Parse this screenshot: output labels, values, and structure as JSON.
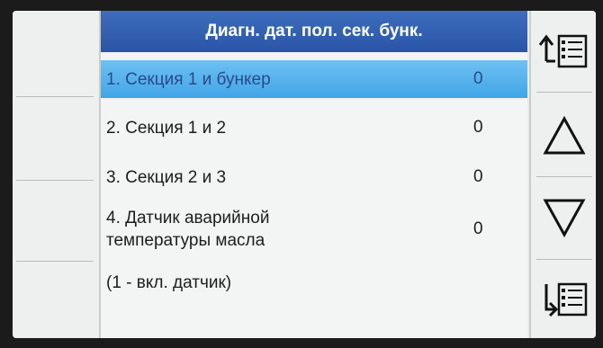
{
  "header": {
    "title": "Диагн. дат. пол. сек. бунк."
  },
  "rows": [
    {
      "label": "1. Секция 1 и бункер",
      "value": "0"
    },
    {
      "label": "2. Секция 1 и 2",
      "value": "0"
    },
    {
      "label": "3. Секция 2 и 3",
      "value": "0"
    },
    {
      "label_line1": "4. Датчик аварийной",
      "label_line2": "температуры масла",
      "value": "0"
    }
  ],
  "note": "(1 - вкл. датчик)",
  "right_buttons": [
    {
      "icon": "menu-up-icon"
    },
    {
      "icon": "triangle-up-icon"
    },
    {
      "icon": "triangle-down-icon"
    },
    {
      "icon": "menu-down-icon"
    }
  ],
  "colors": {
    "header": "#2f5fb0",
    "selected_row": "#4aa9e8",
    "background": "#eef0ef"
  }
}
